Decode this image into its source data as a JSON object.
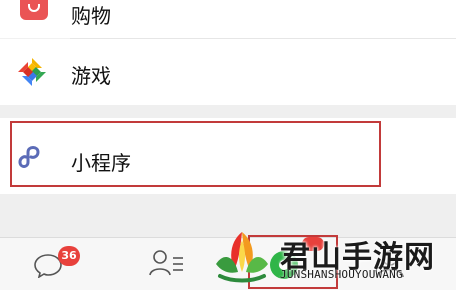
{
  "discover": {
    "items": [
      {
        "label": "购物",
        "icon": "shopping-bag-icon"
      },
      {
        "label": "游戏",
        "icon": "game-color-icon"
      },
      {
        "label": "小程序",
        "icon": "mini-program-icon"
      }
    ]
  },
  "tabbar": {
    "items": [
      {
        "icon": "chats-bubble-icon",
        "badge": "36"
      },
      {
        "icon": "contacts-icon"
      },
      {
        "icon": "discover-icon"
      },
      {
        "icon": "me-icon"
      }
    ]
  },
  "watermark": {
    "title": "君山手游网",
    "subtitle": "JUNSHANSHOUYOUWANG"
  },
  "colors": {
    "highlight_box": "#c23a3a",
    "badge": "#e8413c",
    "mini_program_icon": "#5b6bb7"
  }
}
